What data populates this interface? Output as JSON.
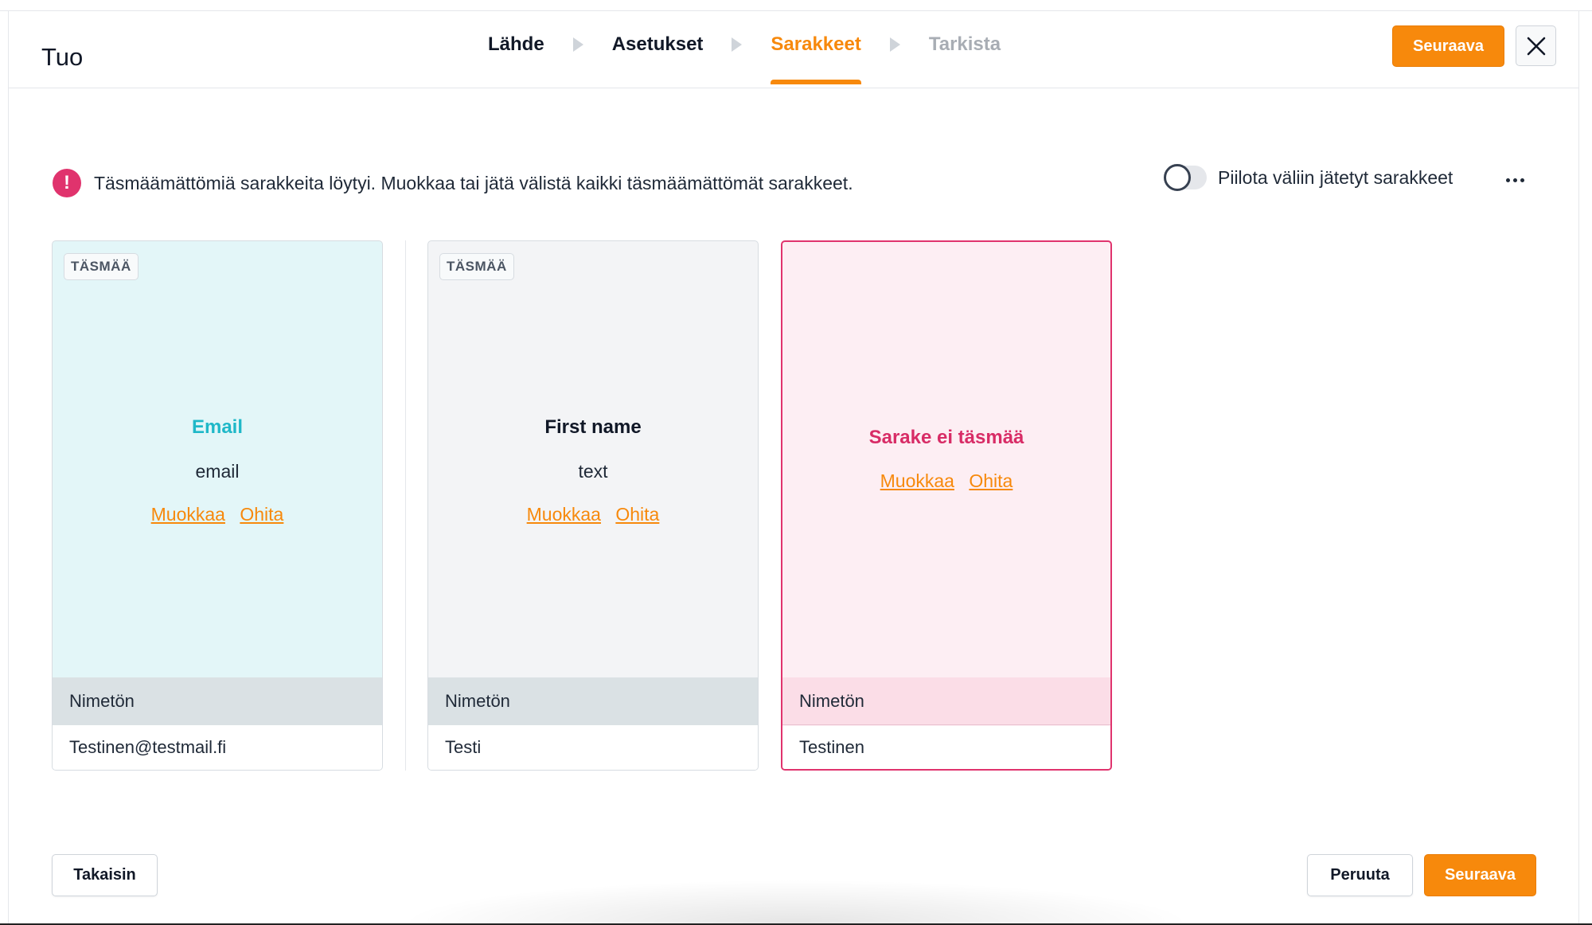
{
  "header": {
    "title": "Tuo",
    "steps": [
      {
        "label": "Lähde",
        "state": "done"
      },
      {
        "label": "Asetukset",
        "state": "done"
      },
      {
        "label": "Sarakkeet",
        "state": "active"
      },
      {
        "label": "Tarkista",
        "state": "disabled"
      }
    ],
    "next_label": "Seuraava",
    "close_icon": "close-icon"
  },
  "notice": {
    "icon": "warning-icon",
    "text": "Täsmäämättömiä sarakkeita löytyi. Muokkaa tai jätä välistä kaikki täsmäämättömät sarakkeet."
  },
  "toggle": {
    "label": "Piilota väliin jätetyt sarakkeet",
    "checked": false
  },
  "columns": [
    {
      "status": "matched",
      "badge": "TÄSMÄÄ",
      "field_name": "Email",
      "field_type": "email",
      "edit_label": "Muokkaa",
      "skip_label": "Ohita",
      "header": "Nimetön",
      "sample": "Testinen@testmail.fi"
    },
    {
      "status": "matched",
      "badge": "TÄSMÄÄ",
      "field_name": "First name",
      "field_type": "text",
      "edit_label": "Muokkaa",
      "skip_label": "Ohita",
      "header": "Nimetön",
      "sample": "Testi"
    },
    {
      "status": "unmatched",
      "field_name": "Sarake ei täsmää",
      "edit_label": "Muokkaa",
      "skip_label": "Ohita",
      "header": "Nimetön",
      "sample": "Testinen"
    }
  ],
  "footer": {
    "back_label": "Takaisin",
    "cancel_label": "Peruuta",
    "next_label": "Seuraava"
  },
  "colors": {
    "accent": "#f7890c",
    "error": "#e0336d",
    "matched_teal": "#1fb8c8"
  }
}
